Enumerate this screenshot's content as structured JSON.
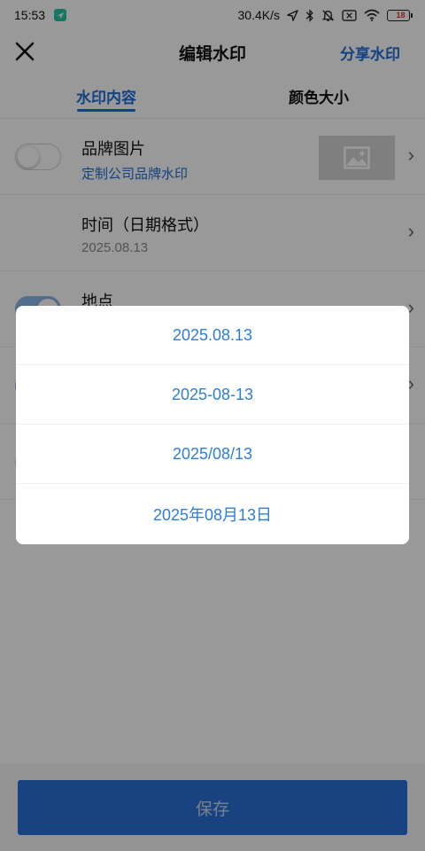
{
  "status_bar": {
    "time": "15:53",
    "network_speed": "30.4K/s",
    "battery": "18",
    "icons": [
      "app-notification-icon",
      "location-icon",
      "bluetooth-icon",
      "mute-icon",
      "sim-icon",
      "wifi-icon",
      "battery-icon"
    ]
  },
  "header": {
    "title": "编辑水印",
    "share_label": "分享水印",
    "close_icon": "close-icon"
  },
  "tabs": [
    {
      "label": "水印内容",
      "active": true
    },
    {
      "label": "颜色大小",
      "active": false
    }
  ],
  "rows": [
    {
      "title": "品牌图片",
      "subtitle": "定制公司品牌水印",
      "toggle_on": false
    },
    {
      "title": "时间（日期格式）",
      "subtitle": "2025.08.13",
      "toggle_on": true
    },
    {
      "title": "地点",
      "subtitle": "",
      "toggle_on": true
    }
  ],
  "save_label": "保存",
  "dialog": {
    "options": [
      "2025.08.13",
      "2025-08-13",
      "2025/08/13",
      "2025年08月13日"
    ]
  },
  "colors": {
    "accent": "#1e6fd9",
    "option_text": "#2d7fd6",
    "save_button": "#2b6fd6"
  }
}
